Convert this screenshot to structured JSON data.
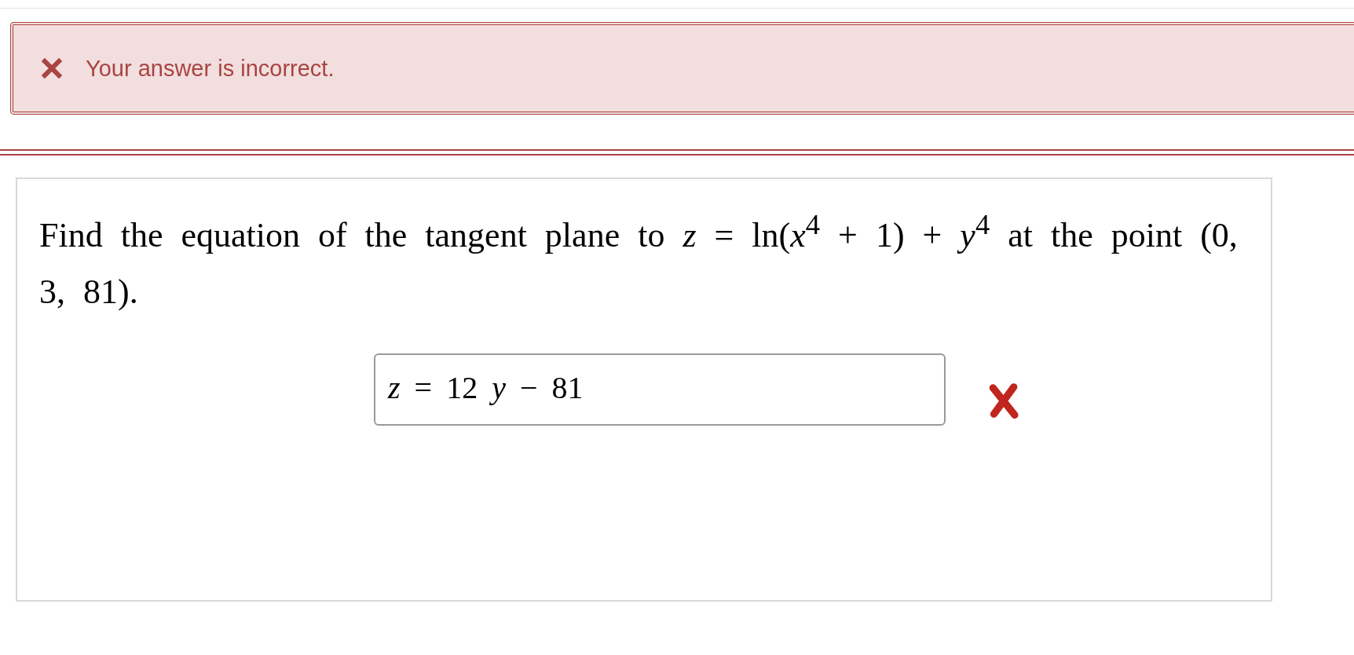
{
  "feedback": {
    "kind": "error",
    "message": "Your answer is incorrect."
  },
  "question": {
    "text": "Find the equation of the tangent plane to *z* = ln(*x*$^{4}$ + 1) + *y*$^{4}$ at the point (0, 3, 81).",
    "answer": {
      "value": "*z* = 12 *y* − 81",
      "correct": false
    }
  }
}
